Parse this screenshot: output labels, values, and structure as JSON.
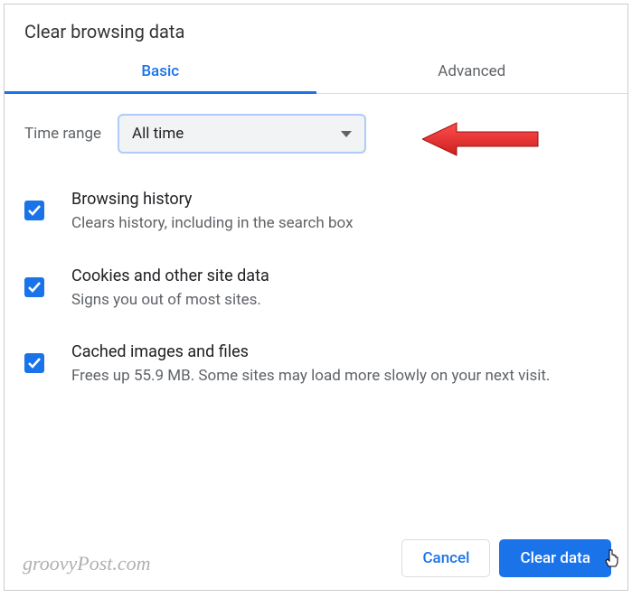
{
  "dialog": {
    "title": "Clear browsing data"
  },
  "tabs": {
    "basic": "Basic",
    "advanced": "Advanced"
  },
  "time_range": {
    "label": "Time range",
    "value": "All time"
  },
  "options": [
    {
      "title": "Browsing history",
      "desc": "Clears history, including in the search box"
    },
    {
      "title": "Cookies and other site data",
      "desc": "Signs you out of most sites."
    },
    {
      "title": "Cached images and files",
      "desc": "Frees up 55.9 MB. Some sites may load more slowly on your next visit."
    }
  ],
  "buttons": {
    "cancel": "Cancel",
    "clear": "Clear data"
  },
  "watermark": "groovyPost.com"
}
